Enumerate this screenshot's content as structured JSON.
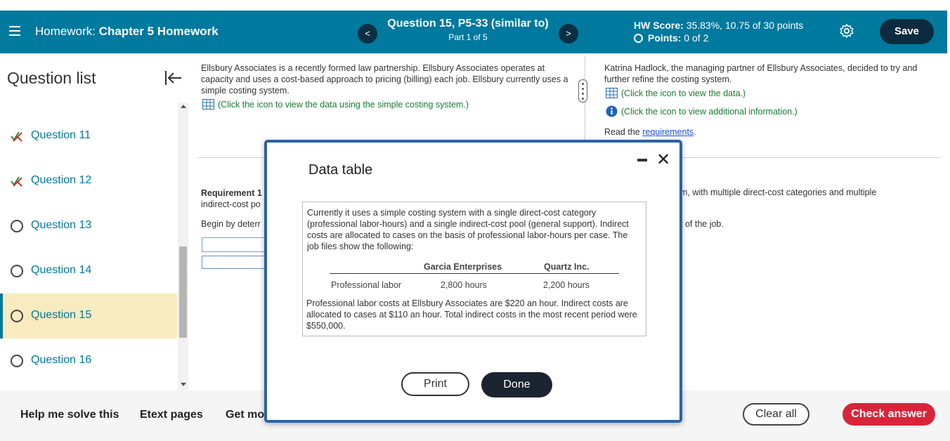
{
  "header": {
    "hw_label": "Homework:",
    "hw_name": "Chapter 5 Homework",
    "question_title": "Question 15, P5-33 (similar to)",
    "question_part": "Part 1 of 5",
    "prev_icon": "<",
    "next_icon": ">",
    "score_label": "HW Score:",
    "score_value": "35.83%, 10.75 of 30 points",
    "points_label": "Points:",
    "points_value": "0 of 2",
    "save_label": "Save"
  },
  "sidebar": {
    "title": "Question list",
    "items": [
      {
        "label": "Question 11",
        "status": "partial"
      },
      {
        "label": "Question 12",
        "status": "partial"
      },
      {
        "label": "Question 13",
        "status": "unanswered"
      },
      {
        "label": "Question 14",
        "status": "unanswered"
      },
      {
        "label": "Question 15",
        "status": "active"
      },
      {
        "label": "Question 16",
        "status": "unanswered"
      }
    ]
  },
  "content": {
    "intro": "Ellsbury Associates is a recently formed law partnership. Ellsbury Associates operates at capacity and uses a cost-based approach to pricing (billing) each job. Ellsbury currently uses a simple costing system.",
    "simple_data_link": "(Click the icon to view the data using the simple costing system.)",
    "right_intro": "Katrina Hadlock, the managing partner of Ellsbury Associates, decided to try and further refine the costing system.",
    "data_link": "(Click the icon to view the data.)",
    "info_link": "(Click the icon to view additional information.)",
    "read_prefix": "Read the",
    "requirements_link": "requirements",
    "read_suffix": ".",
    "req_label": "Requirement 1",
    "req_line2": "indirect-cost po",
    "req_right": "m, with multiple direct-cost categories and multiple",
    "begin_text": "Begin by deterr",
    "begin_right": "t of the job."
  },
  "bottom": {
    "help": "Help me solve this",
    "etext": "Etext pages",
    "get_more": "Get mo",
    "clear_all": "Clear all",
    "check_answer": "Check answer"
  },
  "modal": {
    "title": "Data table",
    "intro": "Currently it uses a simple costing system with a single direct-cost category (professional labor-hours) and a single indirect-cost pool (general support). Indirect costs are allocated to cases on the basis of professional labor-hours per case. The job files show the following:",
    "col1": "Garcia Enterprises",
    "col2": "Quartz Inc.",
    "row_label": "Professional labor",
    "row_val1": "2,800 hours",
    "row_val2": "2,200 hours",
    "outro": "Professional labor costs at Ellsbury Associates are $220 an hour. Indirect costs are allocated to cases at $110 an hour. Total indirect costs in the most recent period were $550,000.",
    "print_label": "Print",
    "done_label": "Done"
  },
  "colors": {
    "header_bg": "#00799e",
    "accent_green": "#1a7a32",
    "check_red": "#d9253a",
    "modal_border": "#2c62a6",
    "active_item_bg": "#f8ebc0"
  }
}
